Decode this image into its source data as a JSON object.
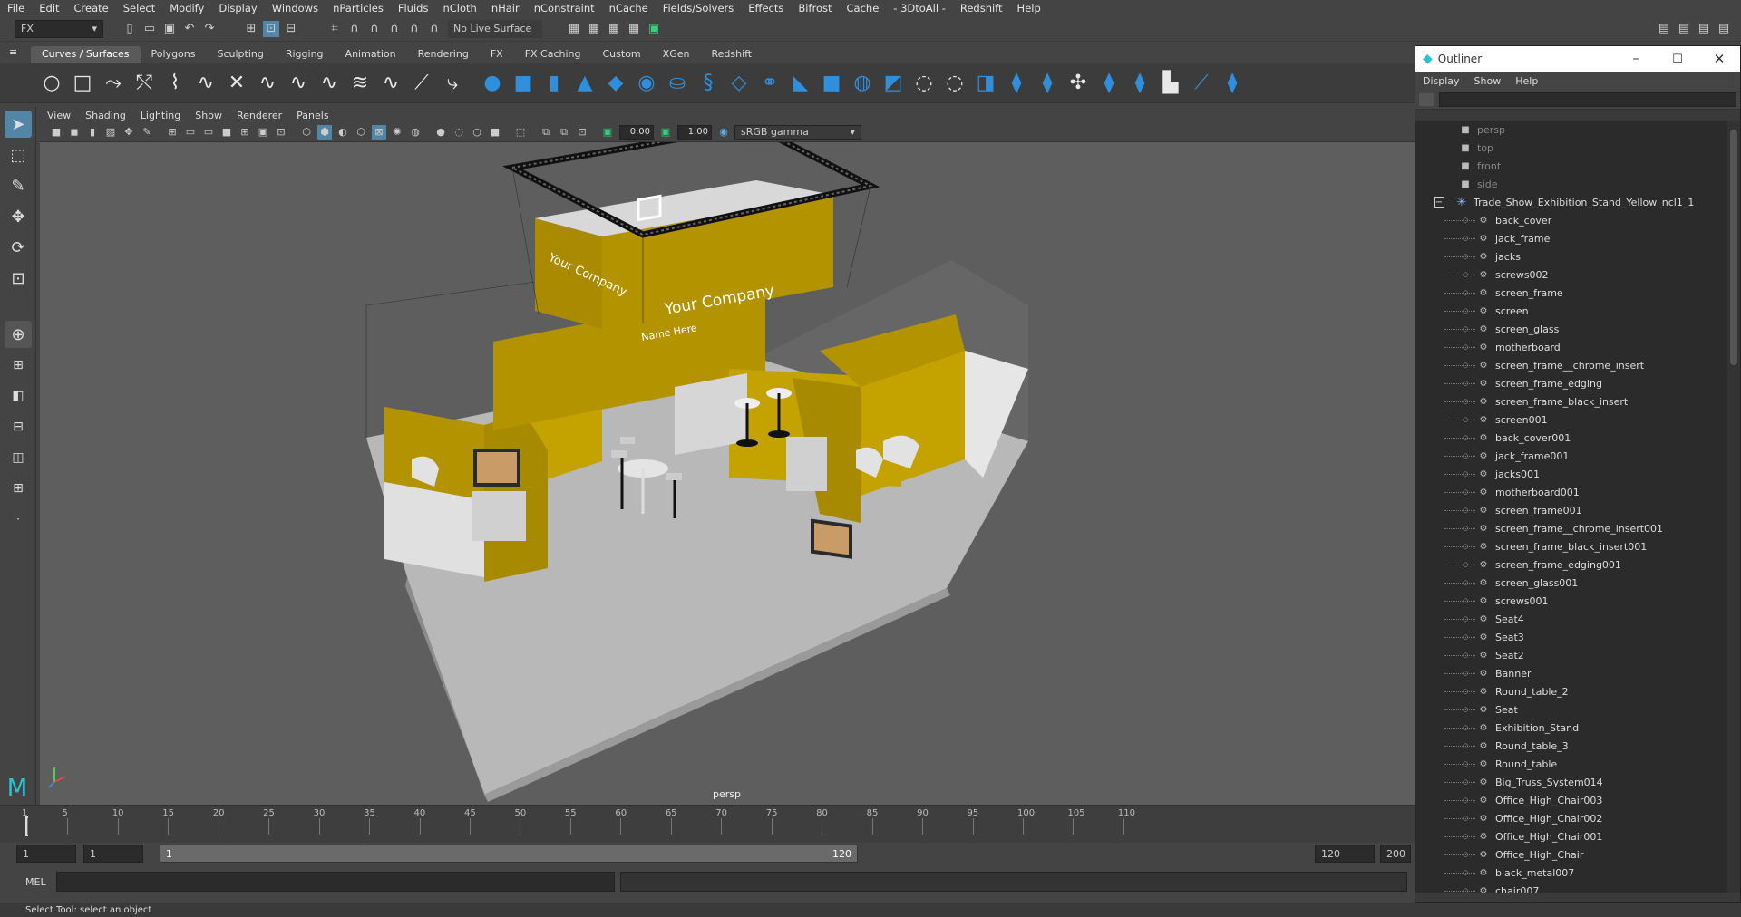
{
  "menubar": [
    "File",
    "Edit",
    "Create",
    "Select",
    "Modify",
    "Display",
    "Windows",
    "nParticles",
    "Fluids",
    "nCloth",
    "nHair",
    "nConstraint",
    "nCache",
    "Fields/Solvers",
    "Effects",
    "Bifrost",
    "Cache",
    "- 3DtoAll -",
    "Redshift",
    "Help"
  ],
  "status": {
    "menuset": "FX",
    "live_surface": "No Live Surface"
  },
  "shelf_tabs": [
    "Curves / Surfaces",
    "Polygons",
    "Sculpting",
    "Rigging",
    "Animation",
    "Rendering",
    "FX",
    "FX Caching",
    "Custom",
    "XGen",
    "Redshift"
  ],
  "active_shelf": "Curves / Surfaces",
  "viewport_menu": [
    "View",
    "Shading",
    "Lighting",
    "Show",
    "Renderer",
    "Panels"
  ],
  "viewport_toolbar": {
    "exposure": "0.00",
    "gamma": "1.00",
    "color_space": "sRGB gamma"
  },
  "viewport_label": "persp",
  "booth": {
    "company": "Your Company",
    "tagline": "Name Here"
  },
  "timeline": {
    "ticks": [
      "1",
      "5",
      "10",
      "15",
      "20",
      "25",
      "30",
      "35",
      "40",
      "45",
      "50",
      "55",
      "60",
      "65",
      "70",
      "75",
      "80",
      "85",
      "90",
      "95",
      "100",
      "105",
      "110"
    ],
    "current_frame": "1"
  },
  "range": {
    "start": "1",
    "playback_start": "1",
    "slider_start": "1",
    "slider_end": "120",
    "playback_end": "120",
    "end": "200"
  },
  "cmdline": {
    "label": "MEL"
  },
  "helpline": "Select Tool: select an object",
  "outliner": {
    "title": "Outliner",
    "menu": [
      "Display",
      "Show",
      "Help"
    ],
    "cameras": [
      "persp",
      "top",
      "front",
      "side"
    ],
    "group": "Trade_Show_Exhibition_Stand_Yellow_ncl1_1",
    "children": [
      "back_cover",
      "jack_frame",
      "jacks",
      "screws002",
      "screen_frame",
      "screen",
      "screen_glass",
      "motherboard",
      "screen_frame__chrome_insert",
      "screen_frame_edging",
      "screen_frame_black_insert",
      "screen001",
      "back_cover001",
      "jack_frame001",
      "jacks001",
      "motherboard001",
      "screen_frame001",
      "screen_frame__chrome_insert001",
      "screen_frame_black_insert001",
      "screen_frame_edging001",
      "screen_glass001",
      "screws001",
      "Seat4",
      "Seat3",
      "Seat2",
      "Banner",
      "Round_table_2",
      "Seat",
      "Exhibition_Stand",
      "Round_table_3",
      "Round_table",
      "Big_Truss_System014",
      "Office_High_Chair003",
      "Office_High_Chair002",
      "Office_High_Chair001",
      "Office_High_Chair",
      "black_metal007",
      "chair007"
    ]
  },
  "colors": {
    "booth_yellow": "#b39300",
    "floor": "#bdbdbd",
    "accent_blue": "#2f8fdc"
  }
}
